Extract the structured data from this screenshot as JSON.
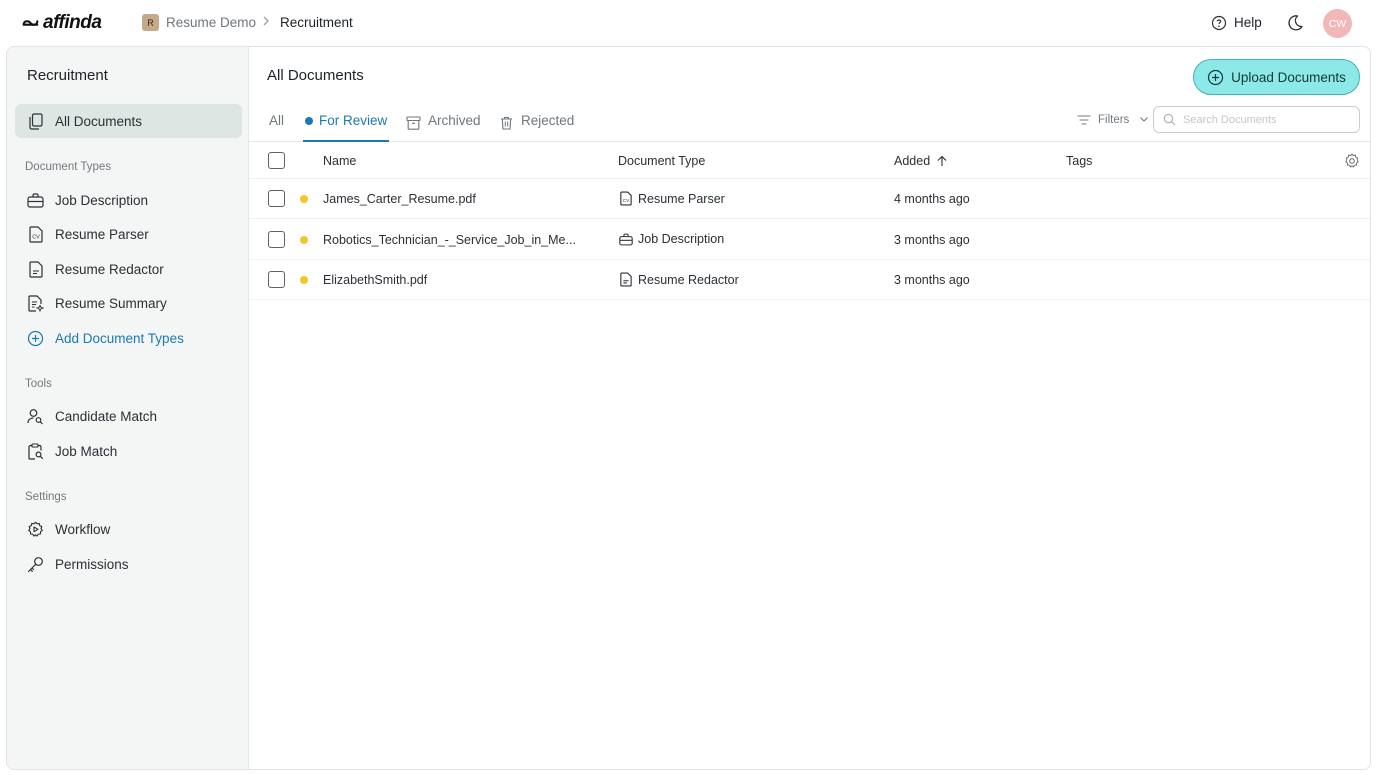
{
  "app": {
    "logo_text": "affinda",
    "workspace_initial": "R",
    "workspace_name": "Resume Demo",
    "breadcrumb_separator": ">",
    "current_collection": "Recruitment",
    "help_label": "Help",
    "user_initials": "CW"
  },
  "sidebar": {
    "title": "Recruitment",
    "all_documents": "All Documents",
    "sections": {
      "document_types": "Document Types",
      "tools": "Tools",
      "settings": "Settings"
    },
    "document_types": [
      {
        "label": "Job Description",
        "icon": "briefcase-icon"
      },
      {
        "label": "Resume Parser",
        "icon": "cv-document-icon"
      },
      {
        "label": "Resume Redactor",
        "icon": "document-icon"
      },
      {
        "label": "Resume Summary",
        "icon": "summary-document-icon"
      }
    ],
    "add_document_types": "Add Document Types",
    "tools": [
      {
        "label": "Candidate Match",
        "icon": "user-search-icon"
      },
      {
        "label": "Job Match",
        "icon": "clipboard-search-icon"
      }
    ],
    "settings": [
      {
        "label": "Workflow",
        "icon": "workflow-gear-icon"
      },
      {
        "label": "Permissions",
        "icon": "key-icon"
      }
    ]
  },
  "main": {
    "title": "All Documents",
    "upload_label": "Upload Documents",
    "tabs": [
      {
        "label": "All",
        "active": false
      },
      {
        "label": "For Review",
        "active": true
      },
      {
        "label": "Archived",
        "active": false
      },
      {
        "label": "Rejected",
        "active": false
      }
    ],
    "filters_label": "Filters",
    "search_placeholder": "Search Documents",
    "columns": {
      "name": "Name",
      "document_type": "Document Type",
      "added": "Added",
      "tags": "Tags"
    },
    "rows": [
      {
        "name": "James_Carter_Resume.pdf",
        "document_type": "Resume Parser",
        "type_icon": "cv-document-icon",
        "added": "4 months ago",
        "status": "for-review"
      },
      {
        "name": "Robotics_Technician_-_Service_Job_in_Me...",
        "document_type": "Job Description",
        "type_icon": "briefcase-icon",
        "added": "3 months ago",
        "status": "for-review"
      },
      {
        "name": "ElizabethSmith.pdf",
        "document_type": "Resume Redactor",
        "type_icon": "document-icon",
        "added": "3 months ago",
        "status": "for-review"
      }
    ]
  },
  "colors": {
    "accent": "#1b7ab2",
    "upload_button": "#8de8e8",
    "review_dot": "#f5c52e",
    "avatar": "#f2b8b8",
    "sidebar_bg": "#f4f5f5",
    "active_item_bg": "#dde6e3"
  }
}
